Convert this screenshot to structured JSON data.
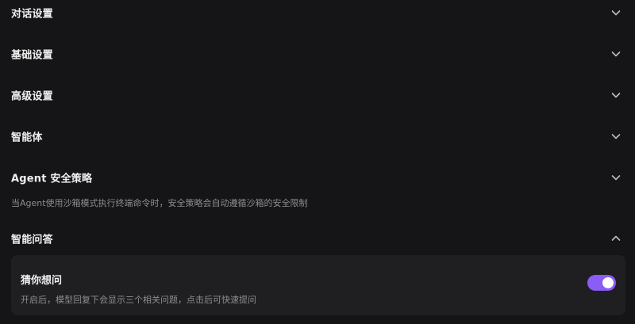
{
  "sections": [
    {
      "title": "对话设置",
      "expanded": false,
      "icon": "chevron-down-icon"
    },
    {
      "title": "基础设置",
      "expanded": false,
      "icon": "chevron-down-icon"
    },
    {
      "title": "高级设置",
      "expanded": false,
      "icon": "chevron-down-icon"
    },
    {
      "title": "智能体",
      "expanded": false,
      "icon": "chevron-down-icon"
    },
    {
      "title": "Agent 安全策略",
      "expanded": false,
      "icon": "chevron-down-icon",
      "description": "当Agent使用沙箱模式执行终端命令时，安全策略会自动遵循沙箱的安全限制"
    },
    {
      "title": "智能问答",
      "expanded": true,
      "icon": "chevron-up-icon"
    }
  ],
  "smart_qa": {
    "setting": {
      "title": "猜你想问",
      "description": "开启后，模型回复下会显示三个相关问题，点击后可快速提问",
      "enabled": true
    }
  },
  "colors": {
    "background": "#151517",
    "card": "#1f1f22",
    "accent": "#8b5cf6",
    "muted_text": "#8d8d93"
  }
}
